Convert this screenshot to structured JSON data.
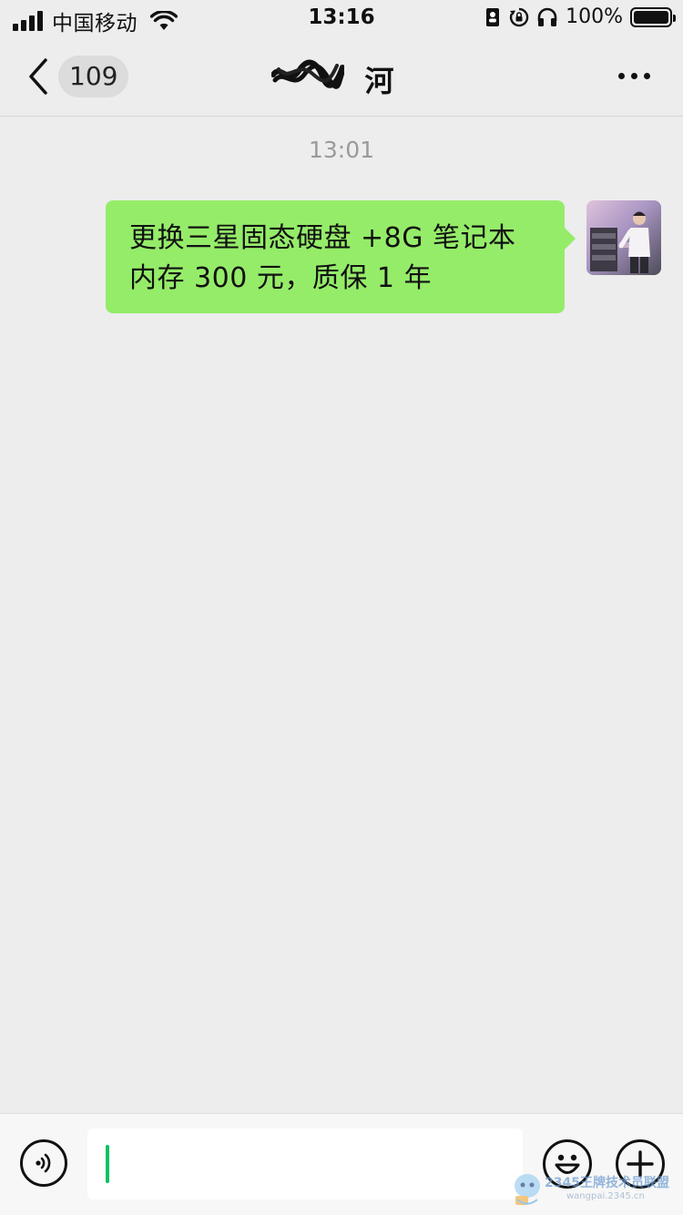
{
  "status_bar": {
    "carrier": "中国移动",
    "time": "13:16",
    "battery_percent": "100%",
    "icons": [
      "signal-icon",
      "wifi-icon",
      "contact-card-icon",
      "rotation-lock-icon",
      "headphones-icon",
      "battery-icon"
    ]
  },
  "nav": {
    "unread_count": "109",
    "title": "河",
    "icons": [
      "back-chevron-icon",
      "more-dots-icon"
    ]
  },
  "chat": {
    "timestamp": "13:01",
    "messages": [
      {
        "sender": "self",
        "lines": [
          "更换三星固态硬盘 +8G 笔记本",
          "内存 300 元，质保 1 年"
        ],
        "bubble_color": "#95ec69"
      }
    ]
  },
  "input_bar": {
    "value": "",
    "caret_color": "#07c160",
    "icons": [
      "voice-icon",
      "emoji-icon",
      "plus-icon"
    ]
  },
  "watermark": {
    "line1": "2345王牌技术员联盟",
    "line2": "wangpai.2345.cn"
  },
  "colors": {
    "background": "#ededed",
    "accent_green": "#07c160"
  }
}
